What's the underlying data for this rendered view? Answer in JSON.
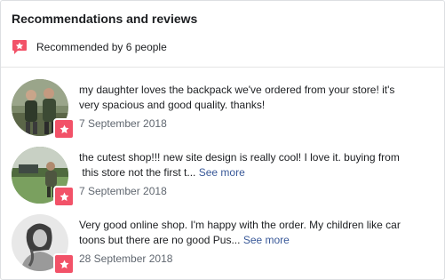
{
  "header": {
    "title": "Recommendations and reviews",
    "recommended_text": "Recommended by 6 people",
    "icon": "recommend-flag-icon",
    "accent_color": "#f25268"
  },
  "reviews": [
    {
      "line1": "my daughter loves the backpack we've ordered from your store! it's",
      "line2": "very spacious and good quality. thanks!",
      "see_more": "",
      "date": "7 September 2018",
      "avatar": "avatar-two-people-photo"
    },
    {
      "line1": "the cutest shop!!! new site design is really cool! I love it. buying from",
      "line2": " this store not the first t...",
      "see_more": "See more",
      "date": "7 September 2018",
      "avatar": "avatar-outdoor-photo"
    },
    {
      "line1": "Very good online shop. I'm happy with the order. My children like car",
      "line2": "toons but there are no good Pus...",
      "see_more": "See more",
      "date": "28 September 2018",
      "avatar": "avatar-woman-bw-photo"
    }
  ],
  "colors": {
    "link": "#385898",
    "muted": "#606770",
    "badge": "#f25268"
  }
}
